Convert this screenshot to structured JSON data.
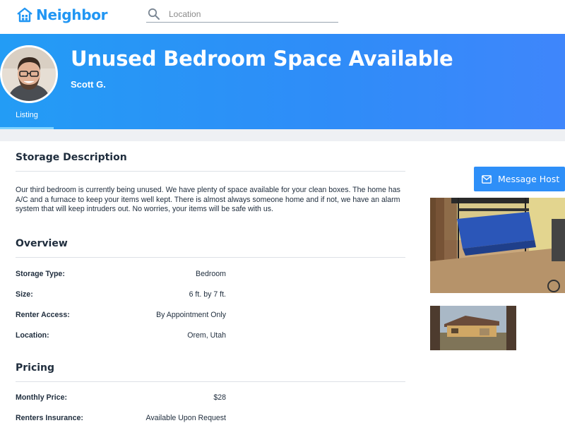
{
  "brand": {
    "name": "Neighbor"
  },
  "search": {
    "placeholder": "Location",
    "value": ""
  },
  "listing": {
    "title": "Unused Bedroom Space Available",
    "host": "Scott G.",
    "tab_label": "Listing"
  },
  "storage_description": {
    "heading": "Storage Description",
    "text": "Our third bedroom is currently being unused. We have plenty of space available for your clean boxes. The home has A/C and a furnace to keep your items well kept. There is almost always someone home and if not, we have an alarm system that will keep intruders out. No worries, your items will be safe with us."
  },
  "overview": {
    "heading": "Overview",
    "rows": [
      {
        "label": "Storage Type:",
        "value": "Bedroom"
      },
      {
        "label": "Size:",
        "value": "6 ft. by 7 ft."
      },
      {
        "label": "Renter Access:",
        "value": "By Appointment Only"
      },
      {
        "label": "Location:",
        "value": "Orem, Utah"
      }
    ]
  },
  "pricing": {
    "heading": "Pricing",
    "rows": [
      {
        "label": "Monthly Price:",
        "value": "$28"
      },
      {
        "label": "Renters Insurance:",
        "value": "Available Upon Request"
      }
    ]
  },
  "actions": {
    "message_host": "Message Host"
  },
  "icons": {
    "logo": "house-logo-icon",
    "search": "search-icon",
    "message": "mail-icon"
  },
  "colors": {
    "brand_blue": "#2196f3",
    "hero_start": "#239cf5",
    "hero_end": "#3f86fb",
    "button_blue": "#2e8ff8",
    "tab_underline": "#7fd3ff"
  }
}
